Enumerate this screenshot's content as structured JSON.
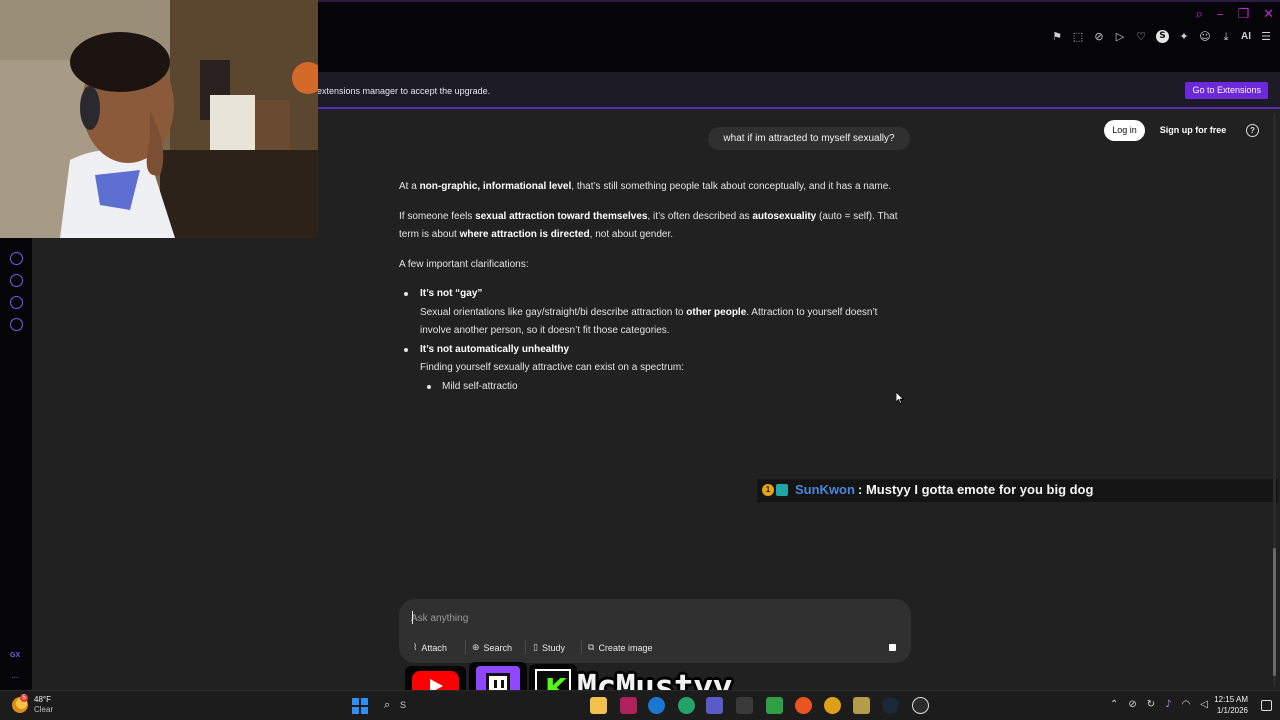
{
  "banner": {
    "text": "extensions manager to accept the upgrade.",
    "button_label": "Go to Extensions"
  },
  "toolbar": {
    "ai_label": "AI",
    "s_label": "S"
  },
  "header": {
    "login_label": "Log in",
    "signup_label": "Sign up for free",
    "help_label": "?"
  },
  "conversation": {
    "user_message": "what if im attracted to myself sexually?",
    "p1": [
      "At a ",
      "non-graphic, informational level",
      ", that’s still something people talk about conceptually, and it has a name."
    ],
    "p2": [
      "If someone feels ",
      "sexual attraction toward themselves",
      ", it’s often described as ",
      "autosexuality",
      " (auto = self). That term is about ",
      "where attraction is directed",
      ", not about gender."
    ],
    "p3": "A few important clarifications:",
    "bullets": [
      {
        "title": "It’s not “gay”",
        "body": [
          "Sexual orientations like gay/straight/bi describe attraction to ",
          "other people",
          ". Attraction to yourself doesn’t involve another person, so it doesn’t fit those categories."
        ]
      },
      {
        "title": "It’s not automatically unhealthy",
        "body": [
          "Finding yourself sexually attractive can exist on a spectrum:"
        ]
      }
    ],
    "sub_bullets": [
      "Mild self-attractio"
    ]
  },
  "chat_overlay": {
    "badge1": "1",
    "username": "SunKwon",
    "message": ": Mustyy I gotta emote for you big dog"
  },
  "composer": {
    "placeholder": "Ask anything",
    "buttons": [
      {
        "label": "Attach",
        "icon": "paperclip-icon"
      },
      {
        "label": "Search",
        "icon": "globe-icon"
      },
      {
        "label": "Study",
        "icon": "book-icon"
      },
      {
        "label": "Create image",
        "icon": "image-icon"
      }
    ]
  },
  "stream_overlay": {
    "channel_name": "McMustyy",
    "kick_letter": "K"
  },
  "taskbar": {
    "temperature": "48°F",
    "condition": "Clear",
    "weather_badge": "5",
    "search_text": "S",
    "time": "12:15 AM",
    "date": "1/1/2026"
  },
  "sidebar": {
    "gx_label": "GX",
    "dots": "..."
  },
  "colors": {
    "accent_purple": "#6d28d9",
    "chat_username": "#4a86d8",
    "page_bg": "#212121"
  }
}
